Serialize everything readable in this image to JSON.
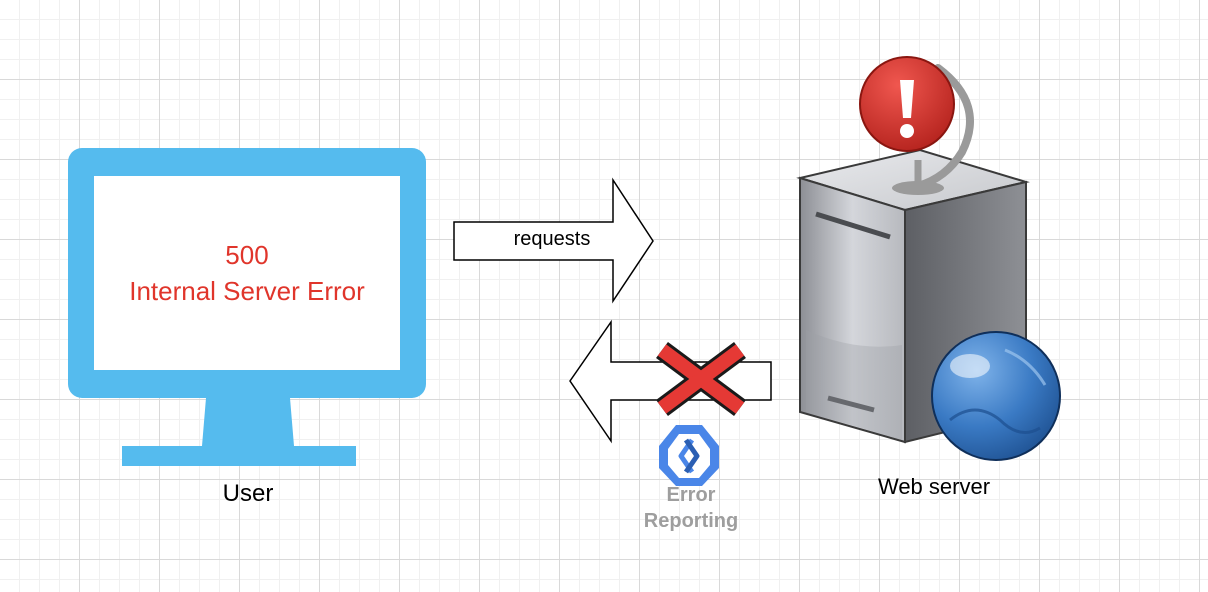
{
  "diagram": {
    "user": {
      "label": "User",
      "screen_code": "500",
      "screen_message": "Internal Server Error"
    },
    "request_arrow": {
      "label": "requests"
    },
    "response_arrow": {
      "blocked": true
    },
    "error_reporting": {
      "line1": "Error",
      "line2": "Reporting"
    },
    "web_server": {
      "label": "Web server"
    }
  },
  "colors": {
    "monitor": "#55bbee",
    "error_text": "#e0352b",
    "alert": "#d32f2f",
    "globe": "#2f6fb5",
    "error_reporting_blue": "#4a86e8",
    "label_gray": "#9e9e9e"
  },
  "icons": [
    "monitor-icon",
    "server-icon",
    "globe-icon",
    "alert-icon",
    "blocked-x-icon",
    "error-reporting-icon"
  ]
}
